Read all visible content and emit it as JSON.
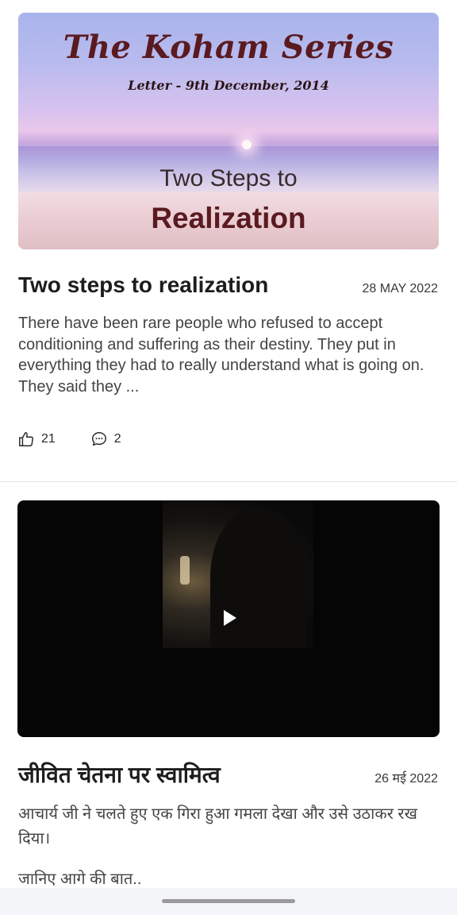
{
  "posts": [
    {
      "banner": {
        "series_title": "The Koham Series",
        "letter_date": "Letter - 9th December, 2014",
        "overlay_line1": "Two Steps to",
        "overlay_line2": "Realization"
      },
      "title": "Two steps to realization",
      "date": "28 MAY 2022",
      "excerpt": "There have been rare people who refused to accept conditioning and suffering as their destiny. They put in everything they had to really understand what is going on. They said they ...",
      "likes": "21",
      "comments": "2"
    },
    {
      "media_type": "video",
      "title": "जीवित चेतना पर स्वामित्व",
      "date": "26 मई 2022",
      "excerpt": "आचार्य जी ने चलते हुए एक गिरा हुआ गमला देखा और उसे उठाकर रख दिया।",
      "excerpt_more": "जानिए आगे की बात.."
    }
  ],
  "icons": {
    "like": "thumbs-up-icon",
    "comment": "speech-bubble-icon",
    "play": "play-icon"
  },
  "colors": {
    "title": "#1d1d1f",
    "excerpt": "#444444",
    "banner_title": "#5a1a1f"
  }
}
